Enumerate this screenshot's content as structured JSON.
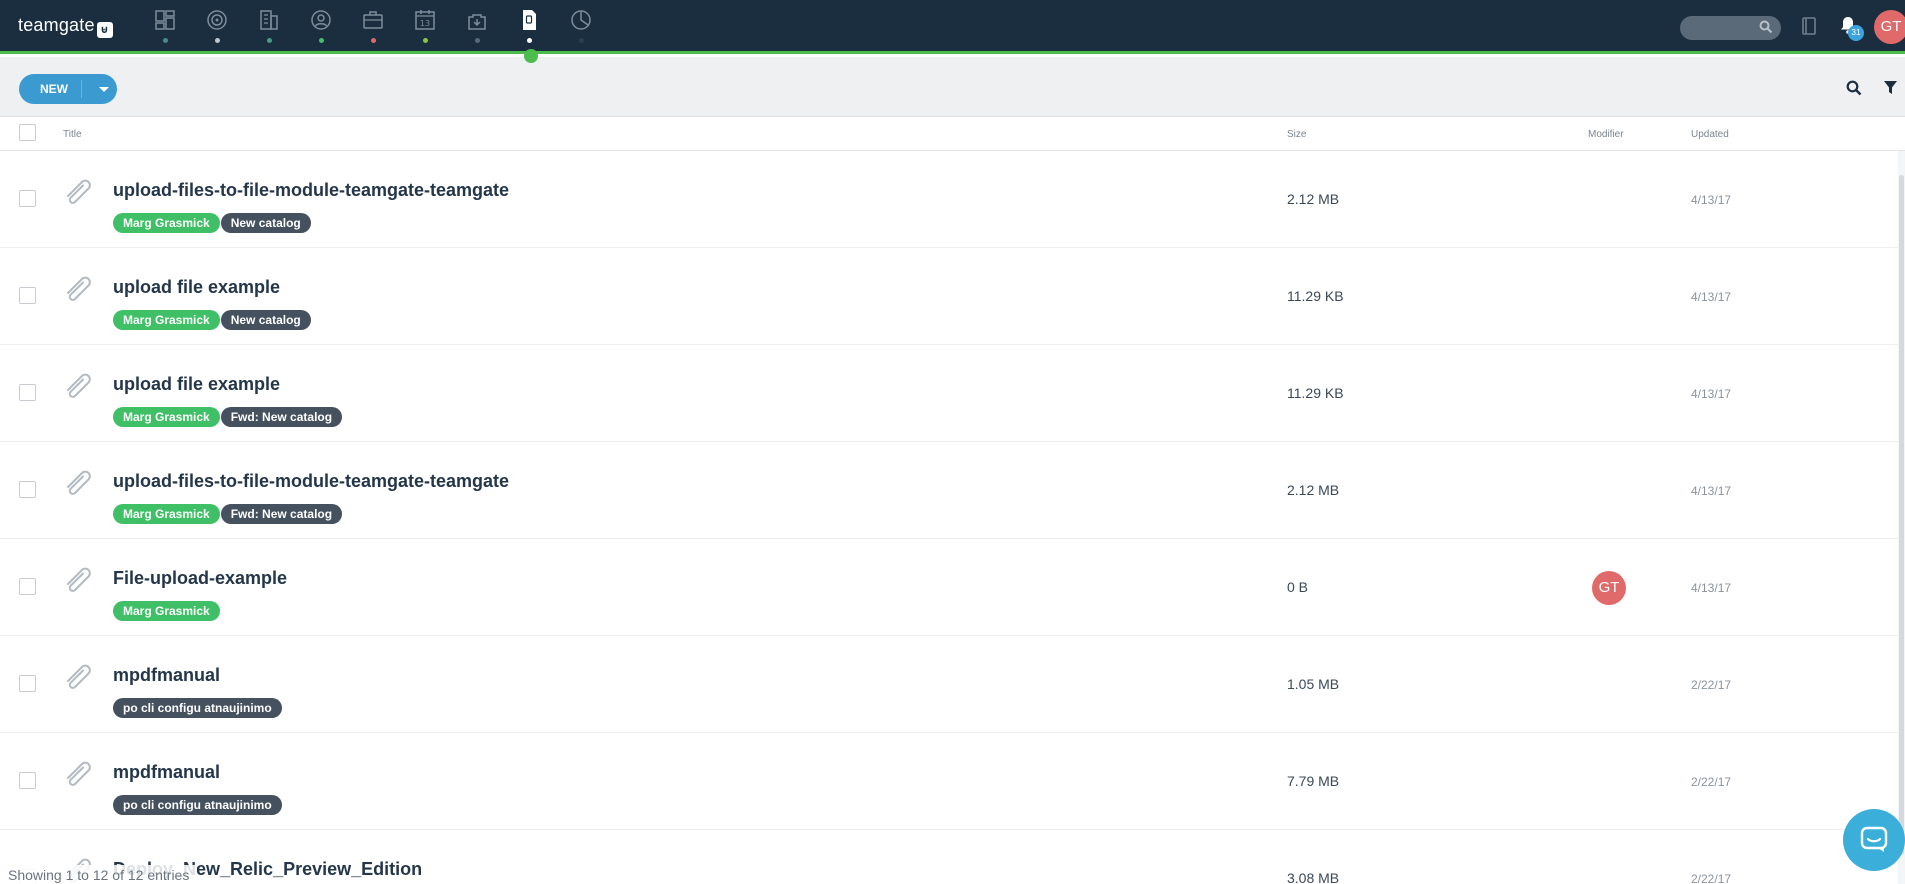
{
  "app": {
    "logo_text": "teamgate",
    "logo_mark": "⊌",
    "accent_color": "#4cbc4c",
    "user_initials": "GT",
    "notification_count": "31"
  },
  "nav": {
    "icons": [
      {
        "name": "dashboard-icon",
        "dot_color": "#4a8a8a"
      },
      {
        "name": "leads-target-icon",
        "dot_color": "#c0c6cc"
      },
      {
        "name": "companies-building-icon",
        "dot_color": "#4a9a8a"
      },
      {
        "name": "people-contact-icon",
        "dot_color": "#3fbf66"
      },
      {
        "name": "deals-briefcase-icon",
        "dot_color": "#e06a6a"
      },
      {
        "name": "calendar-icon",
        "dot_color": "#8ac63a",
        "label": "13"
      },
      {
        "name": "inbox-download-icon",
        "dot_color": "#5a6a79"
      },
      {
        "name": "files-document-icon",
        "dot_color": "#ffffff",
        "active": true
      },
      {
        "name": "reports-pie-icon",
        "dot_color": "#2b3e50"
      }
    ]
  },
  "toolbar": {
    "new_label": "NEW"
  },
  "table": {
    "columns": {
      "title": "Title",
      "size": "Size",
      "modifier": "Modifier",
      "updated": "Updated"
    },
    "rows": [
      {
        "title": "upload-files-to-file-module-teamgate-teamgate",
        "tags": [
          {
            "text": "Marg Grasmick",
            "kind": "green"
          },
          {
            "text": "New catalog",
            "kind": "dark"
          }
        ],
        "size": "2.12 MB",
        "modifier": "",
        "updated": "4/13/17"
      },
      {
        "title": "upload file example",
        "tags": [
          {
            "text": "Marg Grasmick",
            "kind": "green"
          },
          {
            "text": "New catalog",
            "kind": "dark"
          }
        ],
        "size": "11.29 KB",
        "modifier": "",
        "updated": "4/13/17"
      },
      {
        "title": "upload file example",
        "tags": [
          {
            "text": "Marg Grasmick",
            "kind": "green"
          },
          {
            "text": "Fwd: New catalog",
            "kind": "dark"
          }
        ],
        "size": "11.29 KB",
        "modifier": "",
        "updated": "4/13/17"
      },
      {
        "title": "upload-files-to-file-module-teamgate-teamgate",
        "tags": [
          {
            "text": "Marg Grasmick",
            "kind": "green"
          },
          {
            "text": "Fwd: New catalog",
            "kind": "dark"
          }
        ],
        "size": "2.12 MB",
        "modifier": "",
        "updated": "4/13/17"
      },
      {
        "title": "File-upload-example",
        "tags": [
          {
            "text": "Marg Grasmick",
            "kind": "green"
          }
        ],
        "size": "0 B",
        "modifier": "GT",
        "updated": "4/13/17"
      },
      {
        "title": "mpdfmanual",
        "tags": [
          {
            "text": "po cli configu atnaujinimo",
            "kind": "dark"
          }
        ],
        "size": "1.05 MB",
        "modifier": "",
        "updated": "2/22/17"
      },
      {
        "title": "mpdfmanual",
        "tags": [
          {
            "text": "po cli configu atnaujinimo",
            "kind": "dark"
          }
        ],
        "size": "7.79 MB",
        "modifier": "",
        "updated": "2/22/17"
      },
      {
        "title": "Deploy_New_Relic_Preview_Edition",
        "tags": [],
        "size": "3.08 MB",
        "modifier": "",
        "updated": "2/22/17"
      }
    ]
  },
  "footer": {
    "entries_text": "Showing 1 to 12 of 12 entries"
  }
}
